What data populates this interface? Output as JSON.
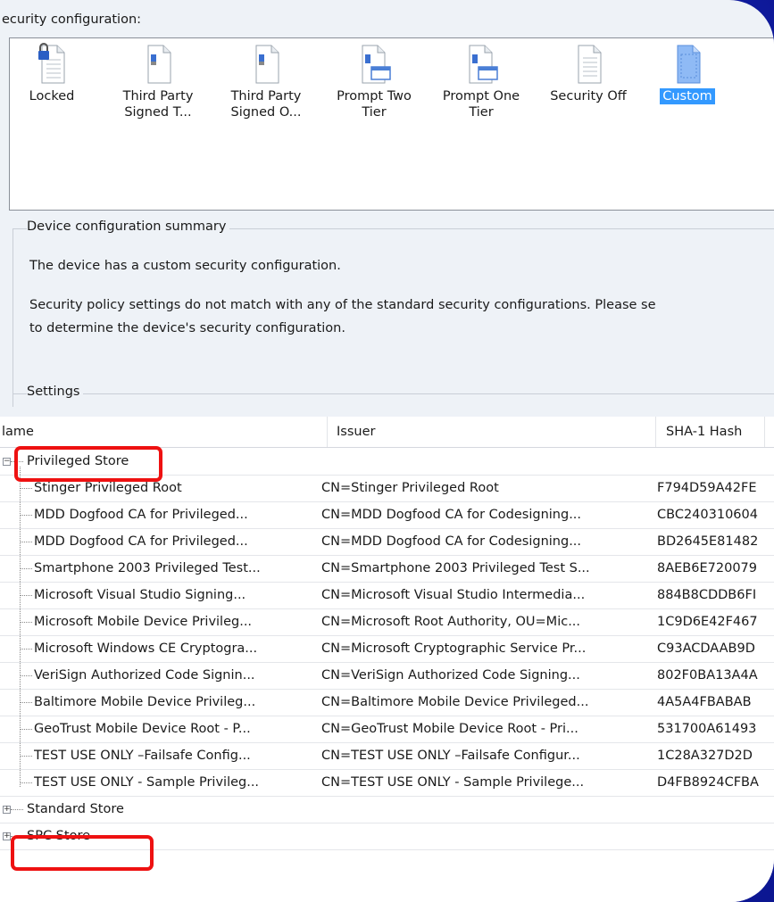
{
  "security_label": "ecurity configuration:",
  "configs": [
    {
      "label_l1": "Locked",
      "label_l2": "",
      "icon": "locked-doc-icon",
      "selected": false
    },
    {
      "label_l1": "Third Party",
      "label_l2": "Signed T...",
      "icon": "signed-doc-icon",
      "selected": false
    },
    {
      "label_l1": "Third Party",
      "label_l2": "Signed O...",
      "icon": "signed-doc-icon",
      "selected": false
    },
    {
      "label_l1": "Prompt Two",
      "label_l2": "Tier",
      "icon": "prompt-doc-icon",
      "selected": false
    },
    {
      "label_l1": "Prompt One",
      "label_l2": "Tier",
      "icon": "prompt-doc-icon",
      "selected": false
    },
    {
      "label_l1": "Security Off",
      "label_l2": "",
      "icon": "plain-doc-icon",
      "selected": false
    },
    {
      "label_l1": "Custom",
      "label_l2": "",
      "icon": "custom-doc-icon",
      "selected": true
    }
  ],
  "summary": {
    "title": "Device configuration summary",
    "line1": "The device has a custom security configuration.",
    "line2": "Security policy settings do not match with any of the standard security configurations. Please se",
    "line3": "to determine the device's security configuration."
  },
  "settings_title": "Settings",
  "table": {
    "headers": [
      "Name",
      "Issuer",
      "SHA-1 Hash"
    ],
    "header_name_visible": "lame",
    "groups": [
      {
        "name": "Privileged Store",
        "expanded": true,
        "rows": [
          {
            "name": "Stinger Privileged Root",
            "issuer": "CN=Stinger Privileged Root",
            "hash": "F794D59A42FE"
          },
          {
            "name": "MDD Dogfood CA for Privileged...",
            "issuer": "CN=MDD Dogfood CA for Codesigning...",
            "hash": "CBC240310604"
          },
          {
            "name": "MDD Dogfood CA for Privileged...",
            "issuer": "CN=MDD Dogfood CA for Codesigning...",
            "hash": "BD2645E81482"
          },
          {
            "name": "Smartphone 2003 Privileged Test...",
            "issuer": "CN=Smartphone 2003 Privileged Test S...",
            "hash": "8AEB6E720079"
          },
          {
            "name": "Microsoft Visual Studio Signing...",
            "issuer": "CN=Microsoft Visual Studio Intermedia...",
            "hash": "884B8CDDB6FI"
          },
          {
            "name": "Microsoft Mobile Device Privileg...",
            "issuer": "CN=Microsoft Root Authority, OU=Mic...",
            "hash": "1C9D6E42F467"
          },
          {
            "name": "Microsoft Windows CE Cryptogra...",
            "issuer": "CN=Microsoft Cryptographic Service Pr...",
            "hash": "C93ACDAAB9D"
          },
          {
            "name": "VeriSign Authorized Code Signin...",
            "issuer": "CN=VeriSign Authorized Code Signing...",
            "hash": "802F0BA13A4A"
          },
          {
            "name": "Baltimore Mobile Device Privileg...",
            "issuer": "CN=Baltimore Mobile Device Privileged...",
            "hash": "4A5A4FBABAB"
          },
          {
            "name": "GeoTrust Mobile Device Root - P...",
            "issuer": "CN=GeoTrust Mobile Device Root - Pri...",
            "hash": "531700A61493"
          },
          {
            "name": "TEST USE ONLY –Failsafe Config...",
            "issuer": "CN=TEST USE ONLY –Failsafe Configur...",
            "hash": "1C28A327D2D"
          },
          {
            "name": "TEST USE ONLY - Sample Privileg...",
            "issuer": "CN=TEST USE ONLY - Sample Privilege...",
            "hash": "D4FB8924CFBA"
          }
        ]
      },
      {
        "name": "Standard Store",
        "expanded": false,
        "rows": []
      },
      {
        "name": "SPC Store",
        "expanded": false,
        "rows": []
      }
    ]
  },
  "colors": {
    "highlight": "#ee1111",
    "selection": "#3399ff",
    "background": "#1422b8"
  }
}
